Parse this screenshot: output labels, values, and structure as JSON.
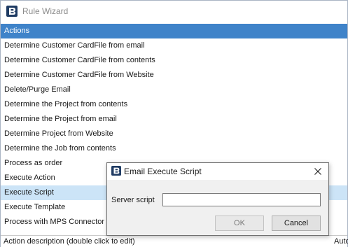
{
  "window": {
    "title": "Rule Wizard",
    "app_icon": "app-logo-icon"
  },
  "actions_header": "Actions",
  "actions": [
    "Determine Customer CardFile from email",
    "Determine Customer CardFile from contents",
    "Determine Customer CardFile from Website",
    "Delete/Purge Email",
    "Determine the Project from contents",
    "Determine the Project from email",
    "Determine Project from Website",
    "Determine the Job from contents",
    "Process as order",
    "Execute Action",
    "Execute Script",
    "Execute Template",
    "Process with MPS Connector"
  ],
  "selected_action": "Execute Script",
  "statusbar": {
    "text": "Action description (double click to edit)",
    "right_text": "Auto"
  },
  "dialog": {
    "title": "Email Execute Script",
    "close_icon": "close-icon",
    "field_label": "Server script",
    "field_value": "",
    "ok_label": "OK",
    "cancel_label": "Cancel"
  },
  "colors": {
    "header_bg": "#3f83c9",
    "selected_bg": "#cce4f7",
    "icon_blue": "#2a5c9a"
  }
}
